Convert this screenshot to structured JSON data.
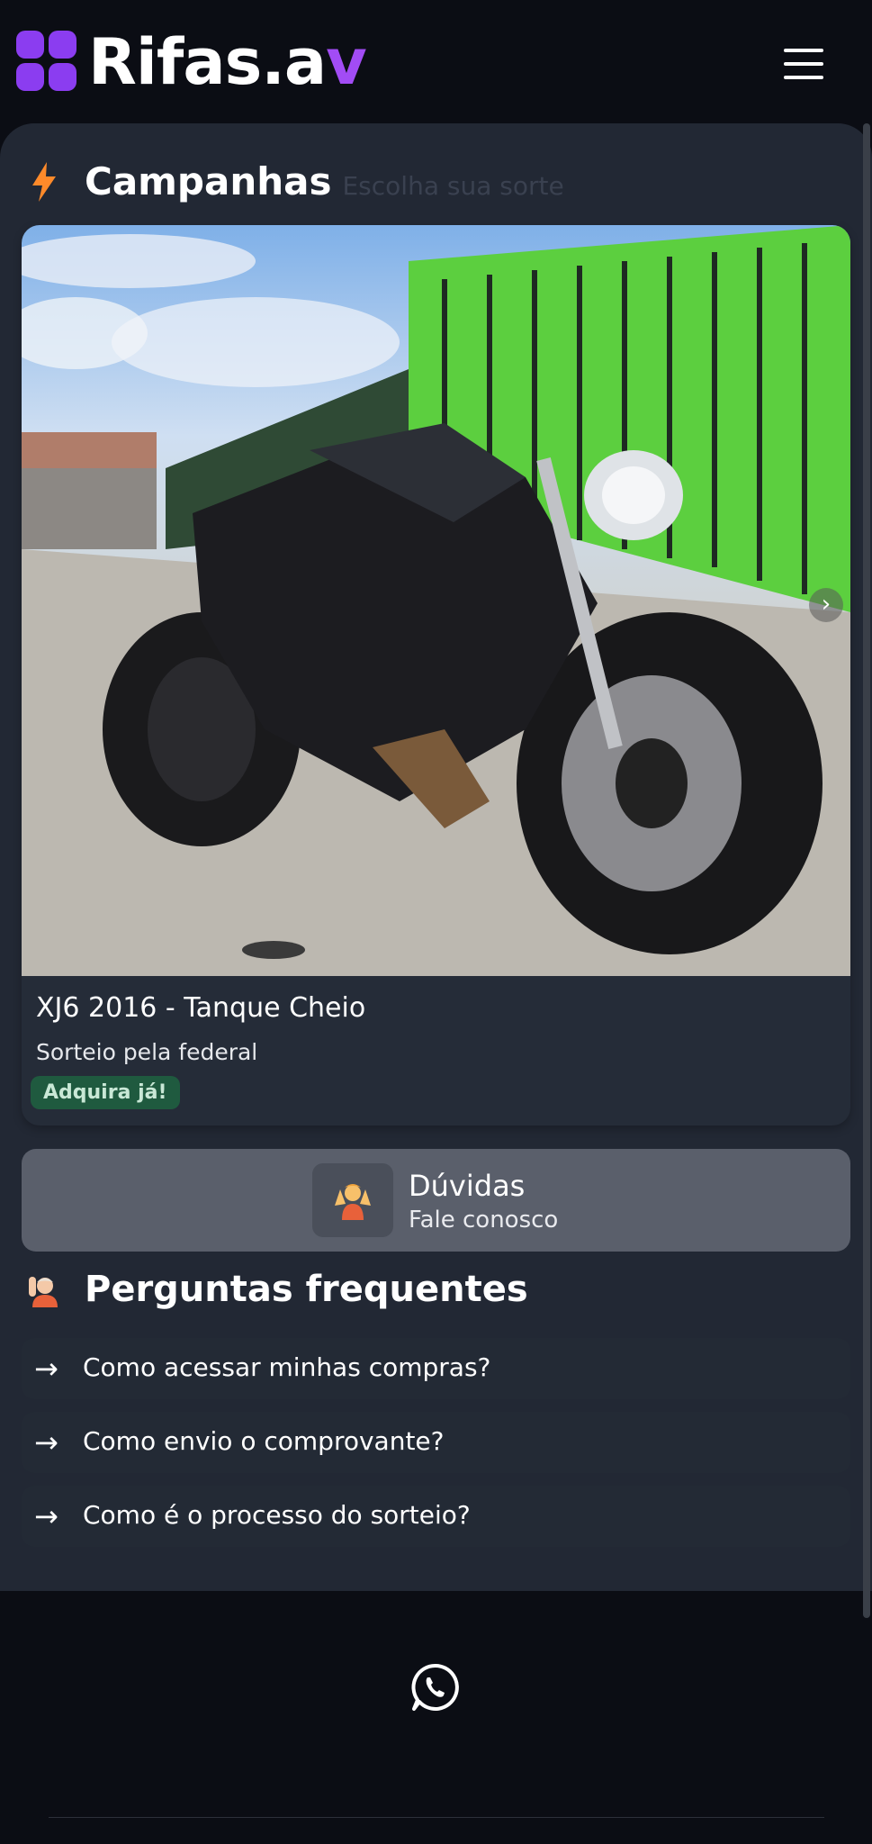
{
  "header": {
    "logo_text": "Rifas.a",
    "logo_accent": "v",
    "menu_icon": "hamburger-menu-icon"
  },
  "campaigns": {
    "title": "Campanhas",
    "subtitle": "Escolha sua sorte",
    "icon": "lightning-bolt-icon"
  },
  "campaign_card": {
    "image_description": "Black Yamaha XJ6 motorcycle",
    "title": "XJ6 2016 - Tanque Cheio",
    "subtitle": "Sorteio pela federal",
    "badge": "Adquira já!",
    "next_icon": "chevron-right-icon"
  },
  "help": {
    "title": "Dúvidas",
    "subtitle": "Fale conosco",
    "icon": "person-shrugging-emoji"
  },
  "faq": {
    "title": "Perguntas frequentes",
    "icon": "person-raising-hand-emoji",
    "items": [
      {
        "question": "Como acessar minhas compras?"
      },
      {
        "question": "Como envio o comprovante?"
      },
      {
        "question": "Como é o processo do sorteio?"
      }
    ]
  },
  "footer": {
    "icon": "whatsapp-icon"
  },
  "colors": {
    "background": "#0b0d14",
    "panel": "#222834",
    "accent": "#8b3df0",
    "badge": "#1f5a3f",
    "help_card": "#5a5f6b"
  }
}
